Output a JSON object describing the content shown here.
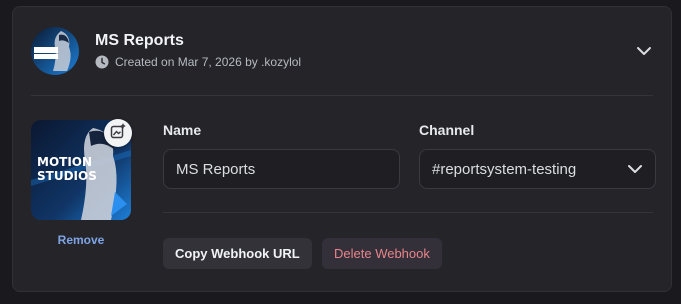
{
  "webhook": {
    "name": "MS Reports",
    "created_text": "Created on Mar 7, 2026 by .kozylol",
    "avatar_text_line1": "MOTION",
    "avatar_text_line2": "STUDIOS"
  },
  "form": {
    "name_label": "Name",
    "name_value": "MS Reports",
    "channel_label": "Channel",
    "channel_value": "#reportsystem-testing",
    "remove_label": "Remove"
  },
  "actions": {
    "copy_label": "Copy Webhook URL",
    "delete_label": "Delete Webhook"
  },
  "icons": [
    "clock-icon",
    "chevron-down-icon",
    "image-upload-icon"
  ],
  "colors": {
    "card_bg": "#242429",
    "link": "#7ea4e6",
    "danger_text": "#e8848a",
    "avatar_blue": "#1d7fd8"
  }
}
